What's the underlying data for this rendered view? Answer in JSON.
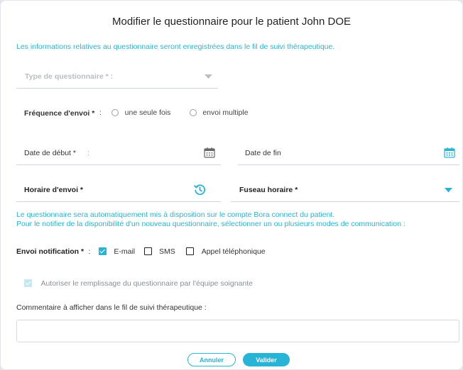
{
  "dialog": {
    "title": "Modifier le questionnaire pour le patient John DOE",
    "info": "Les informations relatives au questionnaire seront enregistrées dans le fil de suivi thérapeutique."
  },
  "questionnaire_type": {
    "label": "Type de questionnaire * :"
  },
  "frequency": {
    "label": "Fréquence d'envoi *",
    "colon": ":",
    "options": [
      "une seule fois",
      "envoi multiple"
    ]
  },
  "dates": {
    "start_label": "Date de début *",
    "start_colon": ":",
    "end_label": "Date de fin"
  },
  "schedule": {
    "time_label": "Horaire d'envoi *",
    "timezone_label": "Fuseau horaire *"
  },
  "notice": {
    "line1": "Le questionnaire sera automatiquement mis à disposition sur le compte Bora connect du patient.",
    "line2": "Pour le notifier de la disponibilité d'un nouveau questionnaire, sélectionner un ou plusieurs modes de communication :"
  },
  "notification": {
    "label": "Envoi notification *",
    "colon": ":",
    "options": [
      {
        "label": "E-mail",
        "checked": true
      },
      {
        "label": "SMS",
        "checked": false
      },
      {
        "label": "Appel téléphonique",
        "checked": false
      }
    ]
  },
  "allow_team": {
    "label": "Autoriser le remplissage du questionnaire par l'équipe soignante",
    "checked": true,
    "disabled": true
  },
  "comment": {
    "label": "Commentaire à afficher dans le fil de suivi thérapeutique :",
    "value": ""
  },
  "buttons": {
    "cancel": "Annuler",
    "confirm": "Valider"
  },
  "colors": {
    "accent": "#27b4d6"
  },
  "icons": [
    "chevron-down-icon",
    "calendar-icon",
    "history-clock-icon",
    "caret-down-icon",
    "check-icon"
  ]
}
